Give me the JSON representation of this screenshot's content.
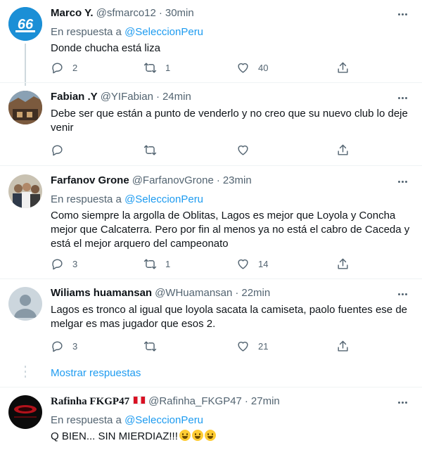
{
  "tweets": [
    {
      "name": "Marco Y.",
      "handle": "@sfmarco12",
      "time": "30min",
      "reply_prefix": "En respuesta a",
      "reply_to": "@SeleccionPeru",
      "text": "Donde chucha está liza",
      "replies": "2",
      "retweets": "1",
      "likes": "40"
    },
    {
      "name": "Fabian .Y",
      "handle": "@YIFabian",
      "time": "24min",
      "text": "Debe ser que están a punto de venderlo y no creo que su nuevo club lo deje venir",
      "replies": "",
      "retweets": "",
      "likes": ""
    },
    {
      "name": "Farfanov Grone",
      "handle": "@FarfanovGrone",
      "time": "23min",
      "reply_prefix": "En respuesta a",
      "reply_to": "@SeleccionPeru",
      "text": "Como siempre la argolla de Oblitas, Lagos es mejor que Loyola y Concha mejor que Calcaterra. Pero por fin al menos ya no está el cabro de Caceda y está el mejor arquero del campeonato",
      "replies": "3",
      "retweets": "1",
      "likes": "14"
    },
    {
      "name": "Wiliams huamansan",
      "handle": "@WHuamansan",
      "time": "22min",
      "text": "Lagos es tronco al igual que loyola sacata la camiseta, paolo fuentes ese de melgar es mas jugador que esos 2.",
      "replies": "3",
      "retweets": "",
      "likes": "21"
    },
    {
      "name": "Rafinha FKGP47",
      "handle": "@Rafinha_FKGP47",
      "time": "27min",
      "reply_prefix": "En respuesta a",
      "reply_to": "@SeleccionPeru",
      "text": "Q BIEN... SIN MIERDIAZ!!!",
      "emoji": "grinning-face-emoji"
    }
  ],
  "show_replies": "Mostrar respuestas",
  "separator_dot": "·",
  "icons": [
    "reply-icon",
    "retweet-icon",
    "like-icon",
    "share-icon",
    "more-icon",
    "peru-flag-icon"
  ],
  "colors": {
    "link": "#1d9bf0",
    "muted": "#536471",
    "text": "#0f1419",
    "line": "#cfd9de"
  }
}
